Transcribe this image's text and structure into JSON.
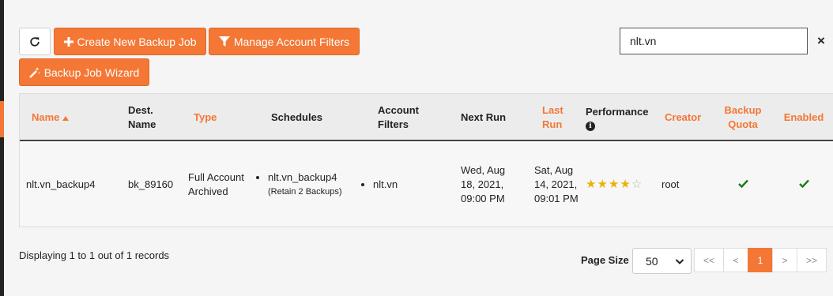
{
  "toolbar": {
    "create_label": "Create New Backup Job",
    "filters_label": "Manage Account Filters",
    "wizard_label": "Backup Job Wizard"
  },
  "search": {
    "value": "nlt.vn",
    "clear": "×"
  },
  "table": {
    "headers": {
      "name": "Name",
      "dest_name": "Dest. Name",
      "type": "Type",
      "schedules": "Schedules",
      "account_filters": "Account Filters",
      "next_run": "Next Run",
      "last_run": "Last Run",
      "performance": "Performance",
      "creator": "Creator",
      "backup_quota": "Backup Quota",
      "enabled": "Enabled"
    },
    "rows": [
      {
        "name": "nlt.vn_backup4",
        "dest_name": "bk_89160",
        "type": "Full Account Archived",
        "schedule_name": "nlt.vn_backup4",
        "schedule_retain": "(Retain 2 Backups)",
        "account_filter": "nlt.vn",
        "next_run": "Wed, Aug 18, 2021, 09:00 PM",
        "last_run": "Sat, Aug 14, 2021, 09:01 PM",
        "performance_stars": 4,
        "performance_max": 5,
        "creator": "root",
        "backup_quota": true,
        "enabled": true
      }
    ]
  },
  "footer": {
    "records_text": "Displaying 1 to 1 out of 1 records",
    "page_size_label": "Page Size",
    "page_size_value": "50",
    "pager": {
      "first": "<<",
      "prev": "<",
      "current": "1",
      "next": ">",
      "last": ">>"
    }
  },
  "colors": {
    "accent": "#f47735",
    "check": "#1a7a1a",
    "star": "#e8b400"
  }
}
